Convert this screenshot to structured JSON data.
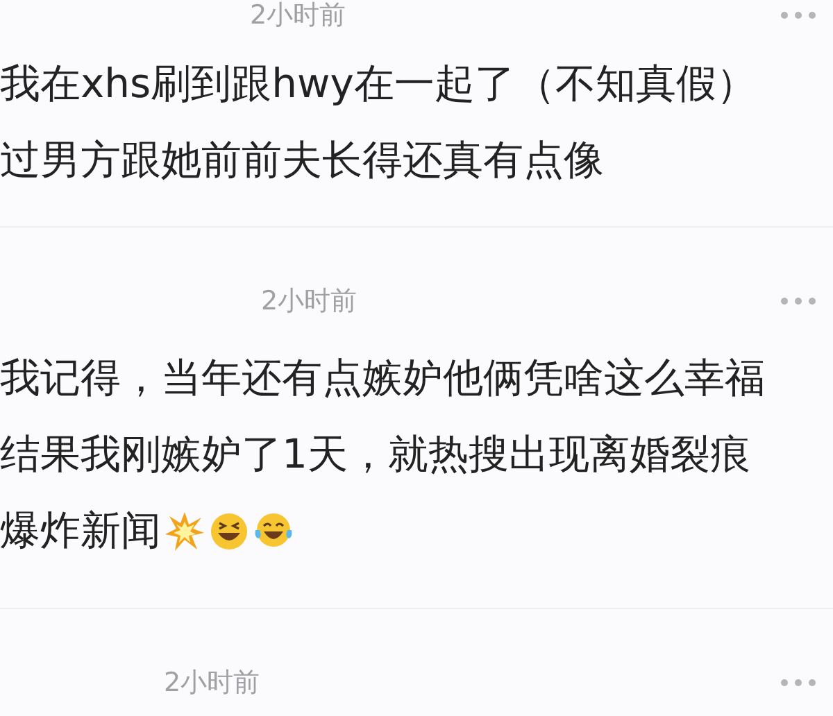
{
  "comments": [
    {
      "time": "2小时前",
      "lines": [
        "我在xhs刷到跟hwy在一起了（不知真假）",
        "过男方跟她前前夫长得还真有点像"
      ]
    },
    {
      "time": "2小时前",
      "lines": [
        "我记得，当年还有点嫉妒他俩凭啥这么幸福",
        "结果我刚嫉妒了1天，就热搜出现离婚裂痕",
        "爆炸新闻"
      ],
      "emojis": [
        {
          "kind": "explosion"
        },
        {
          "kind": "squint"
        },
        {
          "kind": "tears"
        }
      ]
    },
    {
      "time": "2小时前"
    }
  ]
}
